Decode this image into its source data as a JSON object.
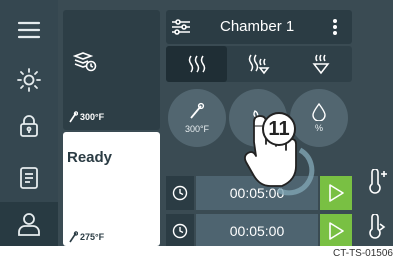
{
  "chamber": {
    "name": "Chamber 1"
  },
  "preheat": {
    "temp": "300°F"
  },
  "status": {
    "text": "Ready",
    "temp": "275°F"
  },
  "controls": {
    "temp_value": "300°F",
    "humidity_value": "%"
  },
  "timers": [
    {
      "time": "00:05:00"
    },
    {
      "time": "00:05:00"
    }
  ],
  "callout": {
    "number": "11"
  },
  "caption": "CT-TS-01506",
  "colors": {
    "screen": "#3a4b53",
    "play": "#79c043",
    "field": "#4e6470"
  }
}
